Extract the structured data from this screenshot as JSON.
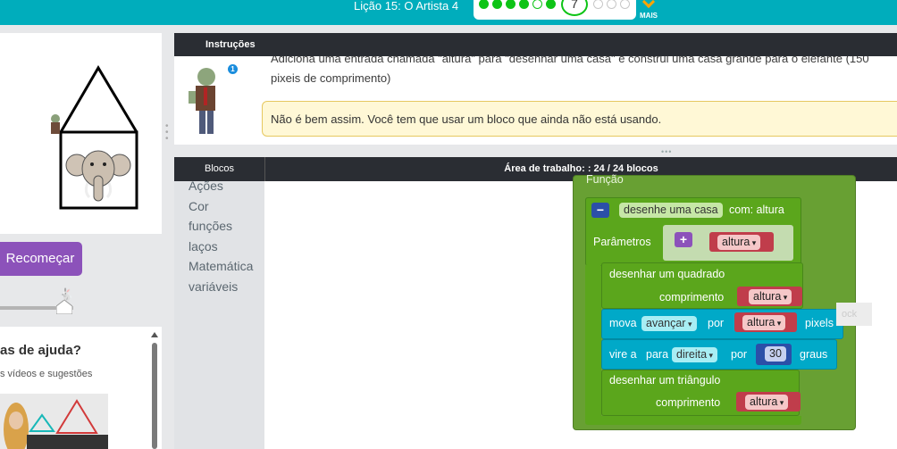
{
  "header": {
    "lesson_title": "Lição 15: O Artista 4",
    "current_level": "7",
    "more_label": "MAIS"
  },
  "left": {
    "restart_label": "Recomeçar",
    "help_title": "as de ajuda?",
    "help_subtitle": "s vídeos e sugestões"
  },
  "instructions": {
    "tab_label": "Instruções",
    "message": "Adiciona uma entrada chamada \"altura\" para \"desenhar uma casa\" e construi uma casa grande para o elefante (150 pixeis de comprimento)",
    "feedback": "Não é bem assim. Você tem que usar um bloco que ainda não está usando.",
    "avatar_badge": "1"
  },
  "workspace": {
    "blocks_tab": "Blocos",
    "header": "Área de trabalho: : 24 / 24 blocos",
    "categories": [
      "Ações",
      "Cor",
      "funções",
      "laços",
      "Matemática",
      "variáveis"
    ],
    "function_label": "Função",
    "def_name": "desenhe uma casa",
    "def_with": "com: altura",
    "params_label": "Parâmetros",
    "param_name": "altura",
    "square_label": "desenhar um quadrado",
    "length_label": "comprimento",
    "var_altura": "altura",
    "move_label": "mova",
    "move_dir": "avançar",
    "by_label": "por",
    "pixels_label": "pixels",
    "turn_label": "vire a",
    "to_label": "para",
    "turn_dir": "direita",
    "degrees": "30",
    "degrees_label": "graus",
    "triangle_label": "desenhar um triângulo",
    "ghost_label": "ock"
  },
  "colors": {
    "header": "#00adbc",
    "function_green": "#68a033",
    "procedure_green": "#5ba61c",
    "cyan": "#00a9c8",
    "variable_red": "#c03d4b",
    "math_blue": "#2b4fa8",
    "purple_button": "#8c52ba"
  }
}
